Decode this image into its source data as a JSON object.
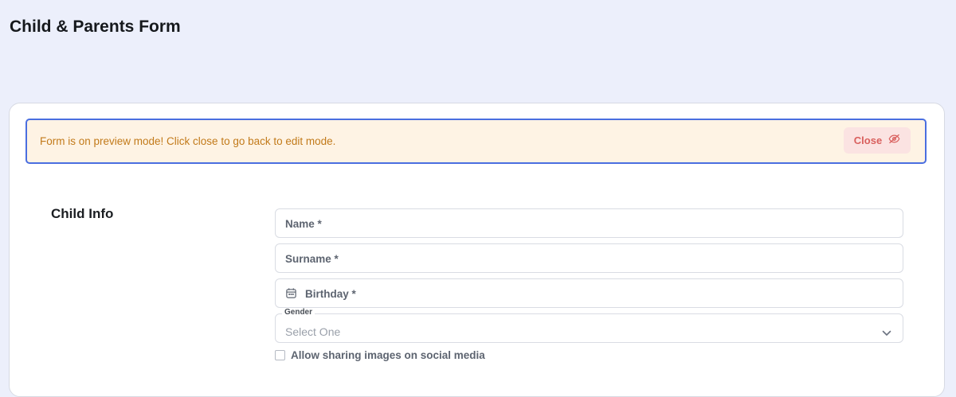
{
  "page": {
    "title": "Child & Parents Form"
  },
  "alert": {
    "message": "Form is on preview mode! Click close to go back to edit mode.",
    "close_label": "Close",
    "close_icon": "eye-off-icon"
  },
  "section": {
    "title": "Child Info"
  },
  "fields": {
    "name": {
      "label": "Name *"
    },
    "surname": {
      "label": "Surname *"
    },
    "birthday": {
      "label": "Birthday *",
      "icon": "calendar-icon"
    },
    "gender": {
      "legend": "Gender",
      "placeholder": "Select One",
      "icon": "chevron-down-icon"
    }
  },
  "consent": {
    "label": "Allow sharing images on social media",
    "checked": false
  },
  "colors": {
    "background": "#eceffb",
    "alert_bg": "#fef3e4",
    "alert_border": "#4a6ee0",
    "alert_text": "#c27a1a",
    "close_bg": "#fbe3e2",
    "close_text": "#d9605e"
  }
}
